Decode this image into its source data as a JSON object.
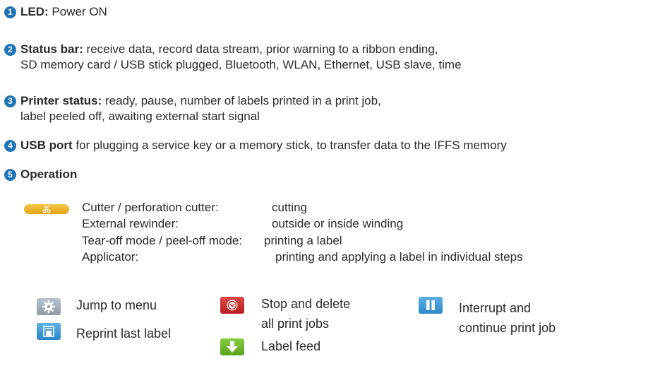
{
  "items": [
    {
      "num": "1",
      "title": "LED:",
      "lines": [
        "Power ON"
      ]
    },
    {
      "num": "2",
      "title": "Status bar:",
      "lines": [
        "receive data, record data stream, prior warning to a ribbon ending,",
        "SD memory card / USB stick plugged, Bluetooth, WLAN, Ethernet, USB slave, time"
      ]
    },
    {
      "num": "3",
      "title": "Printer status:",
      "lines": [
        "ready, pause, number of labels printed in a print job,",
        "label peeled off, awaiting external start signal"
      ]
    },
    {
      "num": "4",
      "title": "USB port",
      "lines": [
        "for plugging a service key or a memory stick, to transfer data to the IFFS memory"
      ]
    },
    {
      "num": "5",
      "title": "Operation",
      "lines": []
    }
  ],
  "operation": {
    "rows": [
      {
        "label": "Cutter / perforation cutter:",
        "value": "cutting"
      },
      {
        "label": "External rewinder:",
        "value": "outside or inside winding"
      },
      {
        "label": "Tear-off mode / peel-off mode:",
        "value": "printing a label"
      },
      {
        "label": "Applicator:",
        "value": "printing and applying a label in individual steps"
      }
    ]
  },
  "keys": {
    "menu": {
      "label": "Jump to menu",
      "icon": "gear-icon",
      "color": "#9aa6b1"
    },
    "reprint": {
      "label": "Reprint last label",
      "icon": "reprint-icon",
      "color": "#3d9ad8"
    },
    "stop": {
      "line1": "Stop and delete",
      "line2": "all print jobs",
      "icon": "stop-icon",
      "color": "#c92b2b"
    },
    "feed": {
      "label": "Label feed",
      "icon": "arrow-down-icon",
      "color": "#6bb52c"
    },
    "pause": {
      "line1": "Interrupt and",
      "line2": "continue print job",
      "icon": "pause-icon",
      "color": "#3d9ad8"
    }
  },
  "accent_color": "#1f74b8"
}
